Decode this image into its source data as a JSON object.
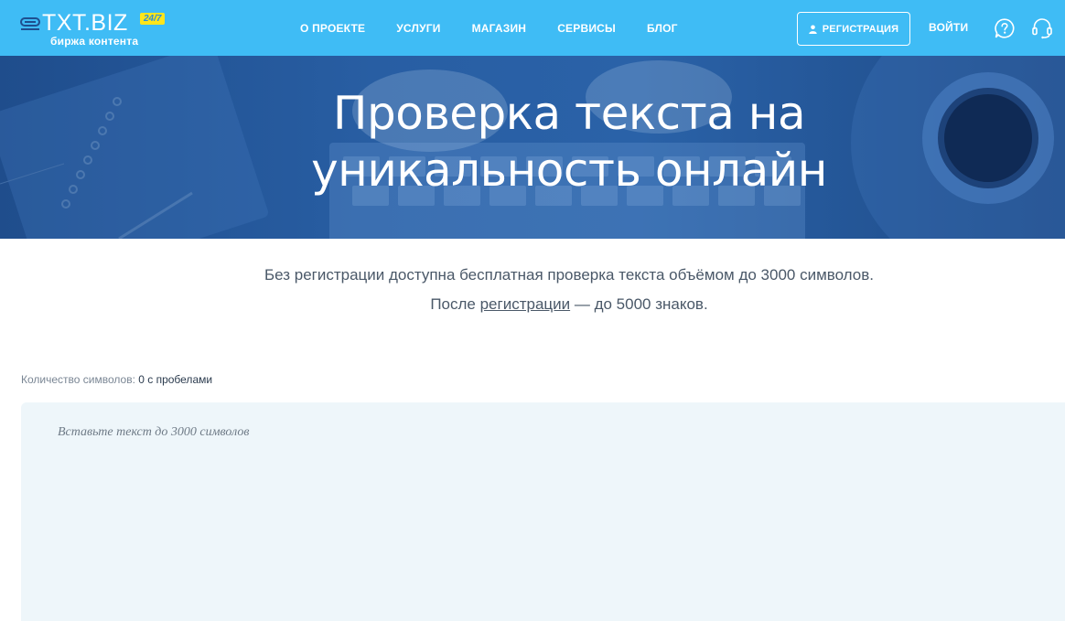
{
  "header": {
    "logo_text": "TXT.BIZ",
    "logo_badge": "24/7",
    "logo_sub": "биржа контента",
    "nav": [
      "О ПРОЕКТЕ",
      "УСЛУГИ",
      "МАГАЗИН",
      "СЕРВИСЫ",
      "БЛОГ"
    ],
    "register_label": "РЕГИСТРАЦИЯ",
    "login_label": "ВОЙТИ",
    "icons": [
      "help-icon",
      "support-headset-icon",
      "user-icon"
    ]
  },
  "hero": {
    "title_line1": "Проверка текста на",
    "title_line2": "уникальность онлайн"
  },
  "intro": {
    "line1": "Без регистрации доступна бесплатная проверка текста объёмом до 3000 символов.",
    "line2_before": "После ",
    "line2_link": "регистрации",
    "line2_after": " — до 5000 знаков."
  },
  "counter": {
    "label": "Количество символов: ",
    "value": "0 с пробелами"
  },
  "editor": {
    "placeholder": "Вставьте текст до 3000 символов",
    "value": ""
  },
  "colors": {
    "header_bg": "#3fbcf5",
    "hero_bg": "#285ea3",
    "badge_bg": "#ffe51a",
    "editor_bg": "#eef6fa"
  }
}
